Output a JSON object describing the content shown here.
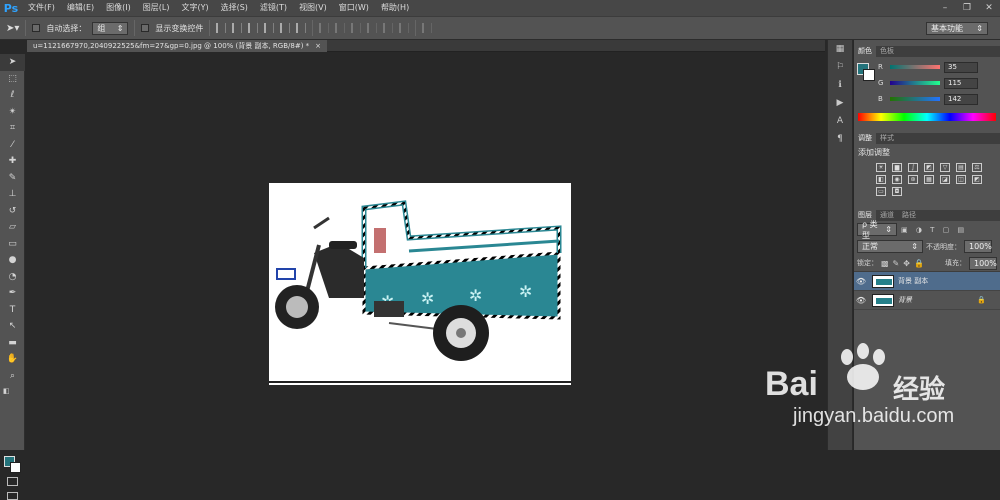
{
  "app": {
    "logo": "Ps"
  },
  "menu": [
    "文件(F)",
    "编辑(E)",
    "图像(I)",
    "图层(L)",
    "文字(Y)",
    "选择(S)",
    "滤镜(T)",
    "视图(V)",
    "窗口(W)",
    "帮助(H)"
  ],
  "window_controls": [
    "–",
    "❐",
    "✕"
  ],
  "options": {
    "auto_select_label": "自动选择：",
    "auto_select_value": "组",
    "transform_label": "显示变换控件",
    "workspace": "基本功能"
  },
  "document": {
    "tab_title": "u=1121667970,2040922525&fm=27&gp=0.jpg @ 100% (背景 副本, RGB/8#) *",
    "tab_close": "×"
  },
  "colors": {
    "foreground": "#23737b",
    "accent_blue": "#2fa3ff",
    "selection_highlight": "#4f6c8c"
  },
  "color_panel": {
    "tabs": [
      "颜色",
      "色板"
    ],
    "r_label": "R",
    "r_value": "35",
    "g_label": "G",
    "g_value": "115",
    "b_label": "B",
    "b_value": "142"
  },
  "adjust_panel": {
    "tabs": [
      "调整",
      "样式"
    ],
    "title": "添加调整"
  },
  "layers_panel": {
    "tabs": [
      "图层",
      "通道",
      "路径"
    ],
    "filter_label": "ρ 类型",
    "blend_mode": "正常",
    "opacity_label": "不透明度：",
    "opacity_value": "100%",
    "lock_label": "锁定：",
    "fill_label": "填充：",
    "fill_value": "100%",
    "layers": [
      {
        "name": "背景 副本",
        "selected": true
      },
      {
        "name": "背景",
        "selected": false
      }
    ]
  },
  "watermark": {
    "brand": "Bai",
    "brand_cn": "经验",
    "url": "jingyan.baidu.com"
  }
}
